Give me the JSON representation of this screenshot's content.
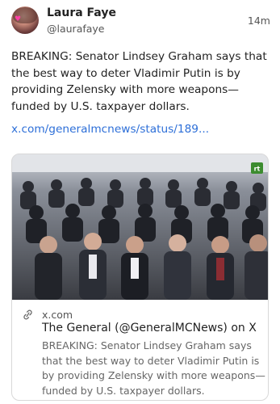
{
  "post": {
    "author_name": "Laura Faye",
    "author_handle": "@laurafaye",
    "time": "14m",
    "text": "BREAKING: Senator Lindsey Graham says that the best way to deter Vladimir Putin is by providing Zelensky with more weapons—funded by U.S. taxpayer dollars.",
    "link_text": "x.com/generalmcnews/status/189..."
  },
  "card": {
    "domain": "x.com",
    "title": "The General (@GeneralMCNews) on X",
    "description": "BREAKING: Senator Lindsey Graham says that the best way to deter Vladimir Putin is by providing Zelensky with more weapons—funded by U.S. taxpayer dollars.",
    "image_badge": "rt"
  },
  "colors": {
    "link": "#2d6fd8",
    "text": "#222222",
    "muted": "#555555",
    "card_border": "#d8d8d8",
    "badge": "#3c8c2f"
  },
  "icons": {
    "link_icon": "chain-link-icon",
    "avatar": "profile-avatar"
  }
}
